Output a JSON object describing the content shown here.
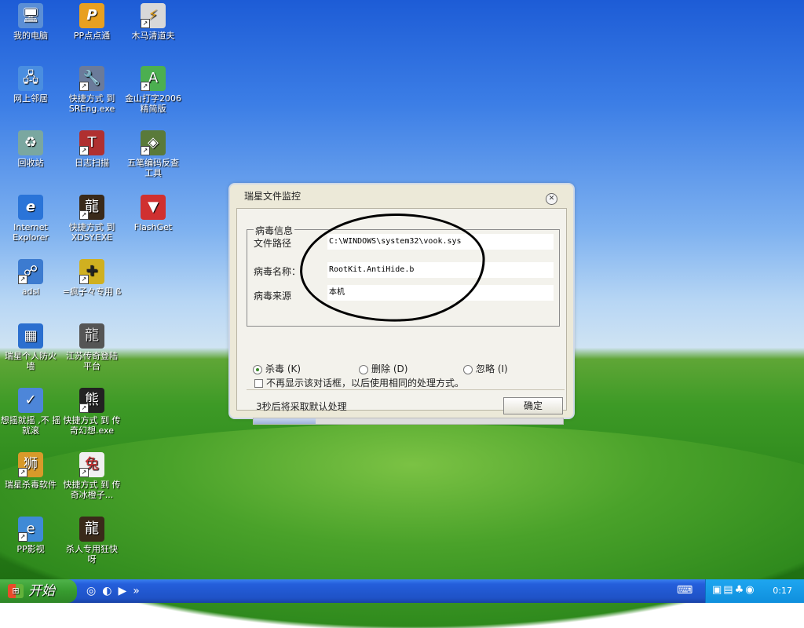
{
  "desktop_icons": [
    {
      "label": "我的电脑",
      "glyph": "🖥"
    },
    {
      "label": "PP点点通",
      "glyph": "P"
    },
    {
      "label": "木马清道夫",
      "glyph": "⚡"
    },
    {
      "label": "网上邻居",
      "glyph": "🖧"
    },
    {
      "label": "快捷方式 到 SREng.exe",
      "glyph": "🔧"
    },
    {
      "label": "金山打字2006 精简版",
      "glyph": "A"
    },
    {
      "label": "回收站",
      "glyph": "♻"
    },
    {
      "label": "日志扫描",
      "glyph": "T"
    },
    {
      "label": "五笔编码反查 工具",
      "glyph": "◈"
    },
    {
      "label": "Internet Explorer",
      "glyph": "e"
    },
    {
      "label": "快捷方式 到 XDSY.EXE",
      "glyph": "龍"
    },
    {
      "label": "FlashGet",
      "glyph": "▼"
    },
    {
      "label": "adsl",
      "glyph": "☍"
    },
    {
      "label": "=疯子々专用 ß",
      "glyph": "✚"
    },
    {
      "label": "瑞星个人防火 墙",
      "glyph": "▦"
    },
    {
      "label": "江苏传奇登陆 平台",
      "glyph": "龍"
    },
    {
      "label": "想摇就摇 ,不 摇就滚",
      "glyph": "✓"
    },
    {
      "label": "快捷方式 到 传奇幻想.exe",
      "glyph": "熊"
    },
    {
      "label": "瑞星杀毒软件",
      "glyph": "狮"
    },
    {
      "label": "快捷方式 到 传奇冰橙子...",
      "glyph": "兔"
    },
    {
      "label": "PP影视",
      "glyph": "e"
    },
    {
      "label": "杀人专用狂快 呀",
      "glyph": "龍"
    }
  ],
  "dialog": {
    "title": "瑞星文件监控",
    "group_title": "病毒信息",
    "rows": [
      {
        "label": "文件路径",
        "value": "C:\\WINDOWS\\system32\\vook.sys"
      },
      {
        "label": "病毒名称：",
        "value": "RootKit.AntiHide.b"
      },
      {
        "label": "病毒来源",
        "value": "本机"
      }
    ],
    "options": [
      {
        "label": "杀毒 (K)",
        "selected": true
      },
      {
        "label": "删除 (D)",
        "selected": false
      },
      {
        "label": "忽略 (I)",
        "selected": false
      }
    ],
    "checkbox_label": "不再显示该对话框，以后使用相同的处理方式。",
    "checkbox_checked": false,
    "countdown_text": "3秒后将采取默认处理",
    "ok_label": "确定",
    "progress_fraction": 0.2
  },
  "taskbar": {
    "start_label": "开始",
    "quick_launch_icons": [
      "ie-icon",
      "media-icon",
      "player-icon"
    ],
    "more_label": "»",
    "tray_icons": [
      "network-icon",
      "firewall-icon",
      "antivirus-icon",
      "volume-icon"
    ],
    "clock": "0:17"
  }
}
